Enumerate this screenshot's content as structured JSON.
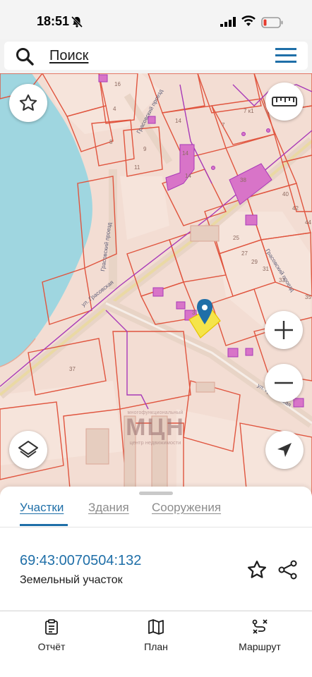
{
  "status_bar": {
    "time": "18:51"
  },
  "search": {
    "label": "Поиск"
  },
  "map": {
    "watermark_top": "многофункциональный",
    "watermark_main": "МЦН",
    "watermark_bottom": "центр недвижимости",
    "street_labels": [
      "Грасовский проезд",
      "Грасовский проезд",
      "Грасовский проезд",
      "ул. Грасовская",
      "ул. Грасовская"
    ],
    "parcel_numbers": [
      "16",
      "4",
      "8",
      "9",
      "11",
      "14",
      "14",
      "14",
      "7",
      "7 к1",
      "38",
      "40",
      "42",
      "44",
      "25",
      "27",
      "29",
      "31",
      "33",
      "35",
      "37",
      "3"
    ]
  },
  "tabs": [
    {
      "label": "Участки",
      "active": true
    },
    {
      "label": "Здания",
      "active": false
    },
    {
      "label": "Сооружения",
      "active": false
    }
  ],
  "selected_object": {
    "cadastral_number": "69:43:0070504:132",
    "object_type": "Земельный участок"
  },
  "bottom_nav": [
    {
      "label": "Отчёт",
      "icon": "report-icon"
    },
    {
      "label": "План",
      "icon": "map-book-icon"
    },
    {
      "label": "Маршрут",
      "icon": "route-icon"
    }
  ],
  "colors": {
    "accent": "#1f6fa8",
    "water": "#9fd6e0",
    "parcel_fill": "#f3ddd3",
    "parcel_border": "#e0553f",
    "building": "#d874c8",
    "selected_parcel": "#f5e44a",
    "district_border": "#a83ab8"
  }
}
